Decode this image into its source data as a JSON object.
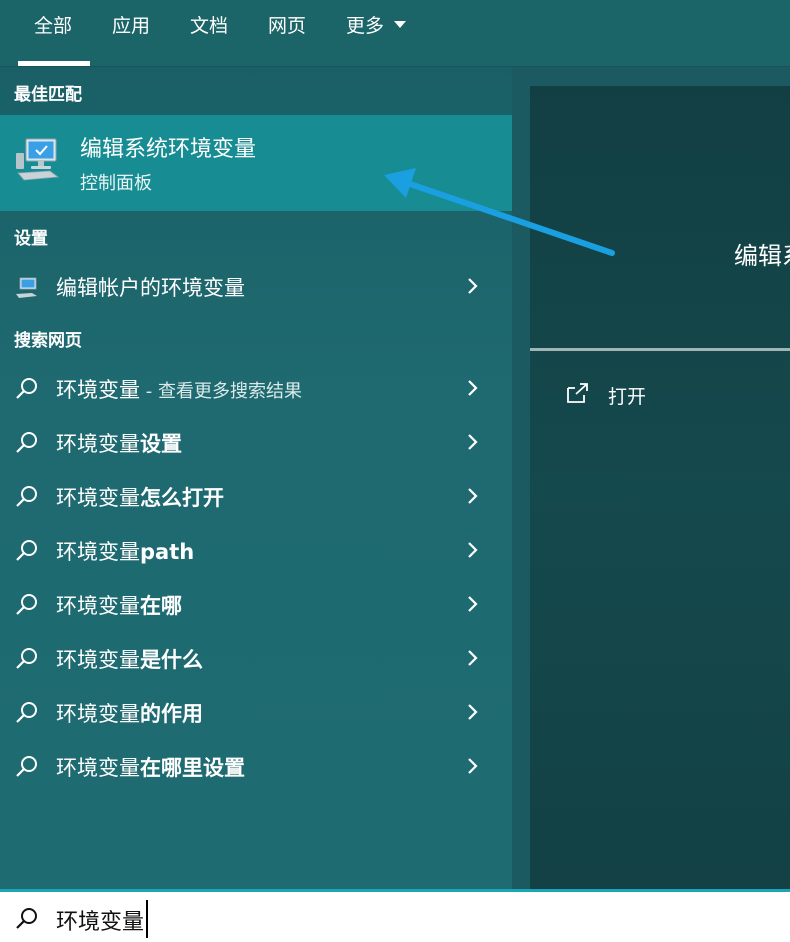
{
  "tabs": [
    {
      "label": "全部",
      "active": true
    },
    {
      "label": "应用"
    },
    {
      "label": "文档"
    },
    {
      "label": "网页"
    },
    {
      "label": "更多"
    }
  ],
  "best_match": {
    "heading": "最佳匹配",
    "title": "编辑系统环境变量",
    "subtitle": "控制面板",
    "icon": "computer-icon"
  },
  "settings": {
    "heading": "设置",
    "items": [
      {
        "label": "编辑帐户的环境变量",
        "icon": "settings-computer-icon"
      }
    ]
  },
  "web": {
    "heading": "搜索网页",
    "items": [
      {
        "prefix": "环境变量",
        "bold": "",
        "suffix": " - 查看更多搜索结果"
      },
      {
        "prefix": "环境变量",
        "bold": "设置",
        "suffix": ""
      },
      {
        "prefix": "环境变量",
        "bold": "怎么打开",
        "suffix": ""
      },
      {
        "prefix": "环境变量",
        "bold": "path",
        "suffix": ""
      },
      {
        "prefix": "环境变量",
        "bold": "在哪",
        "suffix": ""
      },
      {
        "prefix": "环境变量",
        "bold": "是什么",
        "suffix": ""
      },
      {
        "prefix": "环境变量",
        "bold": "的作用",
        "suffix": ""
      },
      {
        "prefix": "环境变量",
        "bold": "在哪里设置",
        "suffix": ""
      }
    ]
  },
  "preview": {
    "title": "编辑系",
    "open_label": "打开"
  },
  "search": {
    "value": "环境变量"
  },
  "colors": {
    "selected": "#178d93",
    "accent": "#1aa7b4",
    "annotation_arrow": "#1a9fe0"
  }
}
